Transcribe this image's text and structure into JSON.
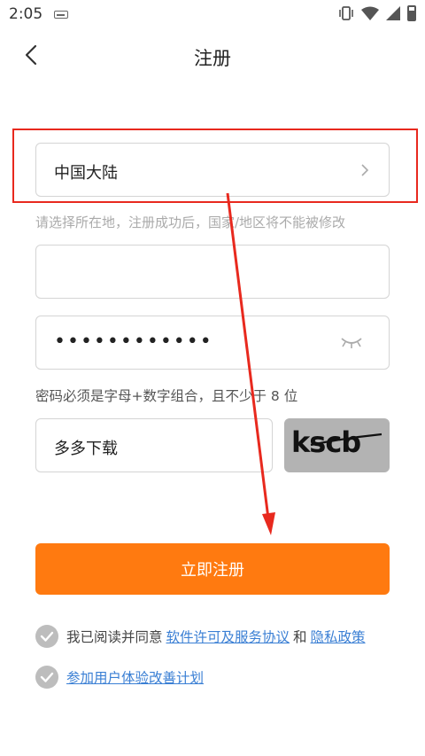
{
  "status_bar": {
    "time": "2:05"
  },
  "header": {
    "title": "注册"
  },
  "region": {
    "value": "中国大陆",
    "hint": "请选择所在地，注册成功后，国家/地区将不能被修改"
  },
  "phone": {
    "value": "",
    "placeholder": ""
  },
  "password": {
    "masked_value": "••••••••••••",
    "hint": "密码必须是字母+数字组合，且不少于 8 位"
  },
  "captcha": {
    "input_value": "多多下载",
    "image_text": "kscb"
  },
  "register_button": {
    "label": "立即注册"
  },
  "agreement": {
    "prefix": "我已阅读并同意",
    "license_link": "软件许可及服务协议",
    "and": "和",
    "privacy_link": "隐私政策",
    "experience_link": "参加用户体验改善计划"
  },
  "colors": {
    "accent": "#ff7a10",
    "link": "#3a7fd4",
    "annotation": "#e8291e"
  }
}
